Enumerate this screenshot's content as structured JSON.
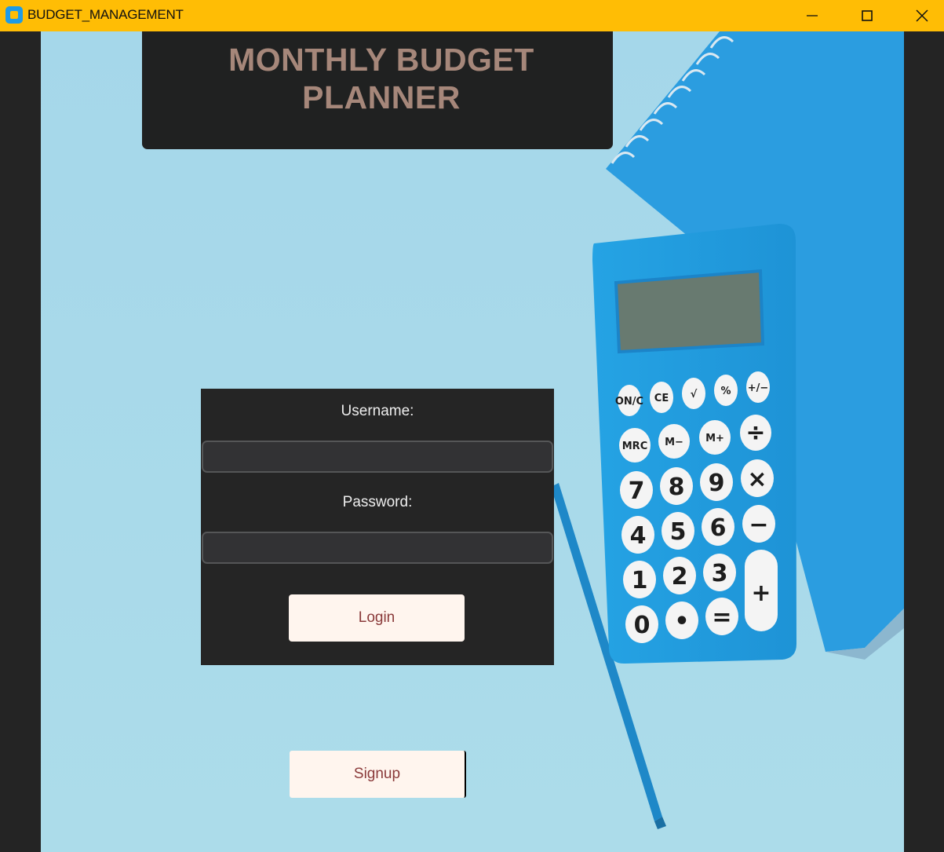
{
  "window": {
    "title": "BUDGET_MANAGEMENT",
    "icon": "app-icon",
    "controls": [
      "minimize-icon",
      "maximize-icon",
      "close-icon"
    ]
  },
  "header": {
    "title_line1": "MONTHLY BUDGET",
    "title_line2": "PLANNER"
  },
  "login": {
    "username_label": "Username:",
    "username_value": "",
    "password_label": "Password:",
    "password_value": "",
    "login_label": "Login"
  },
  "signup": {
    "label": "Signup"
  },
  "background": {
    "calculator_keys": [
      [
        "ON/C",
        "CE",
        "√",
        "%",
        "+/−"
      ],
      [
        "MRC",
        "M−",
        "M+",
        "÷"
      ],
      [
        "7",
        "8",
        "9",
        "×"
      ],
      [
        "4",
        "5",
        "6",
        "−"
      ],
      [
        "1",
        "2",
        "3",
        "+"
      ],
      [
        "0",
        "•",
        "="
      ]
    ]
  },
  "colors": {
    "titlebar": "#FFBD05",
    "background": "#A7D9EB",
    "header_text": "#A6877A",
    "panel": "#252525",
    "button_bg": "#FFF5EE",
    "button_text": "#8A3A3A"
  }
}
